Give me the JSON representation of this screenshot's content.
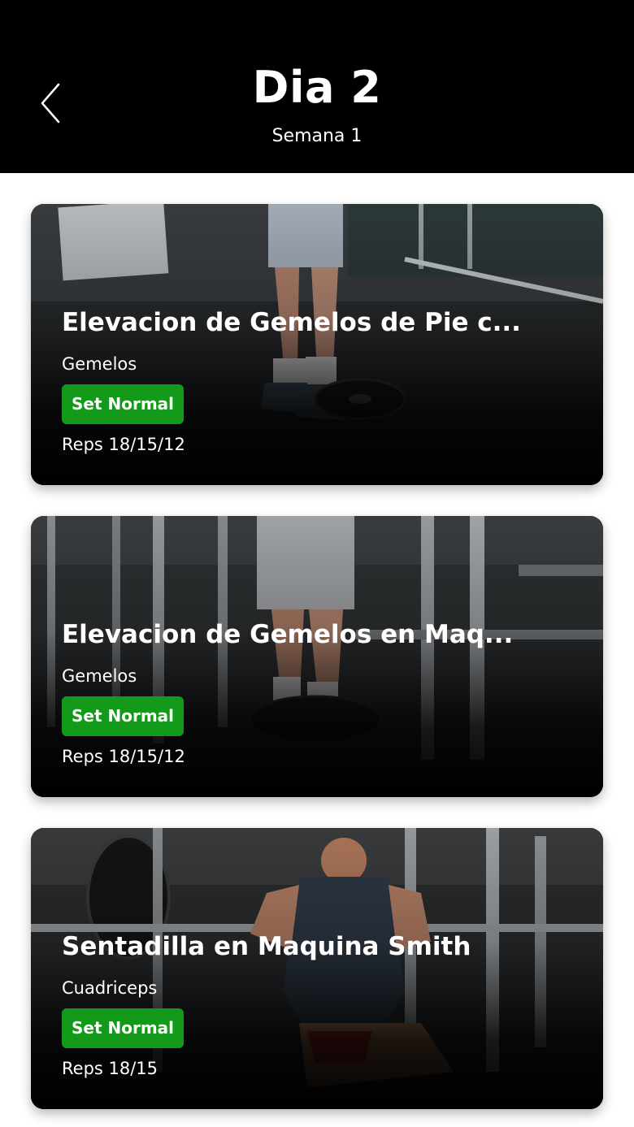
{
  "header": {
    "title": "Dia 2",
    "subtitle": "Semana 1",
    "back_icon": "chevron-left-icon"
  },
  "colors": {
    "header_bg": "#000000",
    "badge_bg": "#139a1b",
    "text": "#ffffff"
  },
  "exercises": [
    {
      "name": "Elevacion de Gemelos de Pie c...",
      "muscle": "Gemelos",
      "set_type": "Set Normal",
      "reps": "Reps 18/15/12"
    },
    {
      "name": "Elevacion de Gemelos en Maq...",
      "muscle": "Gemelos",
      "set_type": "Set Normal",
      "reps": "Reps 18/15/12"
    },
    {
      "name": "Sentadilla en Maquina Smith",
      "muscle": "Cuadriceps",
      "set_type": "Set Normal",
      "reps": "Reps 18/15"
    }
  ]
}
